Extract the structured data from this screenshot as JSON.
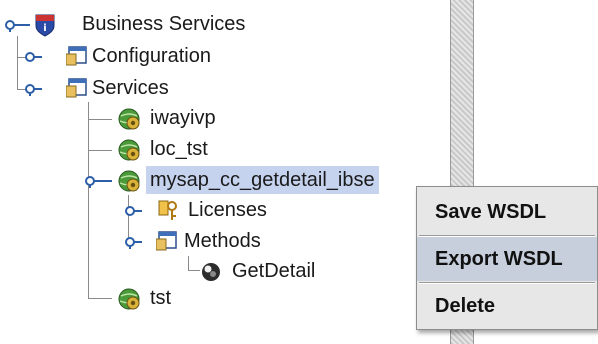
{
  "tree": {
    "root": {
      "label": "Business Services",
      "icon": "business-services-shield-icon"
    },
    "configuration": {
      "label": "Configuration",
      "icon": "folder-window-icon"
    },
    "services": {
      "label": "Services",
      "icon": "folder-window-icon"
    },
    "service_items": [
      {
        "label": "iwayivp",
        "icon": "service-gear-globe-icon"
      },
      {
        "label": "loc_tst",
        "icon": "service-gear-globe-icon"
      },
      {
        "label": "mysap_cc_getdetail_ibse",
        "icon": "service-gear-globe-icon",
        "selected": true
      },
      {
        "label": "tst",
        "icon": "service-gear-globe-icon"
      }
    ],
    "licenses": {
      "label": "Licenses",
      "icon": "license-key-icon"
    },
    "methods": {
      "label": "Methods",
      "icon": "folder-window-icon"
    },
    "getdetail": {
      "label": "GetDetail",
      "icon": "method-ball-icon"
    }
  },
  "context_menu": {
    "items": [
      {
        "label": "Save WSDL",
        "highlighted": false
      },
      {
        "label": "Export WSDL",
        "highlighted": true
      },
      {
        "label": "Delete",
        "highlighted": false
      }
    ]
  },
  "colors": {
    "selection": "#c6d3ef",
    "menu_bg": "#e7e7e7",
    "menu_hover": "#c7cfdc"
  }
}
